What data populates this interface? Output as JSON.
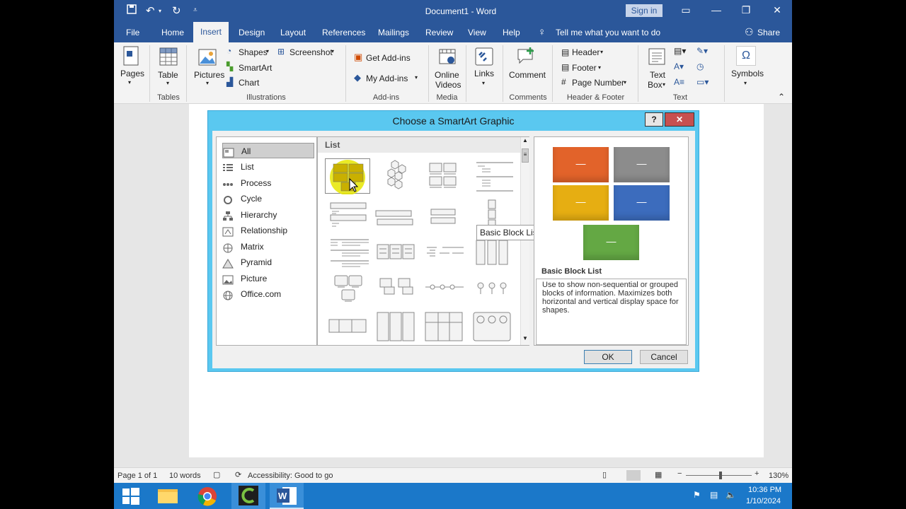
{
  "window": {
    "title": "Document1  -  Word",
    "sign_in": "Sign in"
  },
  "tabs": [
    {
      "label": "File"
    },
    {
      "label": "Home"
    },
    {
      "label": "Insert"
    },
    {
      "label": "Design"
    },
    {
      "label": "Layout"
    },
    {
      "label": "References"
    },
    {
      "label": "Mailings"
    },
    {
      "label": "Review"
    },
    {
      "label": "View"
    },
    {
      "label": "Help"
    }
  ],
  "tell_me": "Tell me what you want to do",
  "share": "Share",
  "ribbon": {
    "pages": "Pages",
    "table": "Table",
    "pictures": "Pictures",
    "shapes": "Shapes",
    "smartart": "SmartArt",
    "chart": "Chart",
    "screenshot": "Screenshot",
    "get_addins": "Get Add-ins",
    "my_addins": "My Add-ins",
    "online_videos_1": "Online",
    "online_videos_2": "Videos",
    "links": "Links",
    "comment": "Comment",
    "header": "Header",
    "footer": "Footer",
    "page_number": "Page Number",
    "text_box_1": "Text",
    "text_box_2": "Box",
    "symbols": "Symbols",
    "groups": {
      "tables": "Tables",
      "illustrations": "Illustrations",
      "addins": "Add-ins",
      "media": "Media",
      "comments": "Comments",
      "header_footer": "Header & Footer",
      "text": "Text"
    }
  },
  "dialog": {
    "title": "Choose a SmartArt Graphic",
    "help": "?",
    "close": "✕",
    "categories": [
      {
        "label": "All",
        "icon": "all-icon"
      },
      {
        "label": "List",
        "icon": "list-icon"
      },
      {
        "label": "Process",
        "icon": "process-icon"
      },
      {
        "label": "Cycle",
        "icon": "cycle-icon"
      },
      {
        "label": "Hierarchy",
        "icon": "hierarchy-icon"
      },
      {
        "label": "Relationship",
        "icon": "relationship-icon"
      },
      {
        "label": "Matrix",
        "icon": "matrix-icon"
      },
      {
        "label": "Pyramid",
        "icon": "pyramid-icon"
      },
      {
        "label": "Picture",
        "icon": "picture-icon"
      },
      {
        "label": "Office.com",
        "icon": "globe-icon"
      }
    ],
    "gallery_header": "List",
    "tooltip": "Basic Block List",
    "preview_name": "Basic Block List",
    "preview_desc": "Use to show non-sequential or grouped blocks of information. Maximizes both horizontal and vertical display space for shapes.",
    "preview_colors": [
      "#e2632a",
      "#8c8c8c",
      "#e6ae12",
      "#3c6cbd",
      "#64a844"
    ],
    "ok": "OK",
    "cancel": "Cancel"
  },
  "status": {
    "page": "Page 1 of 1",
    "words": "10 words",
    "accessibility": "Accessibility: Good to go",
    "zoom": "130%"
  },
  "taskbar": {
    "time": "10:36 PM",
    "date": "1/10/2024"
  }
}
